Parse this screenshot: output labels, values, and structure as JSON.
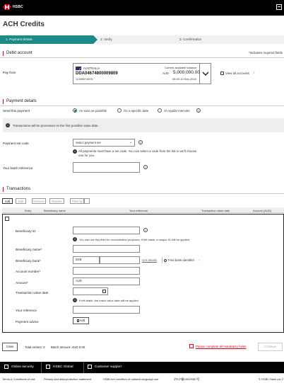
{
  "header": {
    "brand": "HSBC"
  },
  "page": {
    "title": "ACH Credits"
  },
  "steps": [
    "1. Payment details",
    "2. Verify",
    "3. Confirmation"
  ],
  "required_note": "*Indicates required fields",
  "debit": {
    "section": "Debit account",
    "pay_from_label": "Pay from",
    "country": "AUSTRALIA",
    "account": "DDA04674800009809",
    "account_sub": "12345576578",
    "balance_label": "Current available balance",
    "currency": "AUD",
    "balance": "5,000,000.00",
    "as_of": "08.00.10 Sep.2016",
    "view_all": "View all accounts"
  },
  "payment": {
    "section": "Payment details",
    "send_label": "Send this payment",
    "options": [
      "As soon as possible",
      "On a specific date",
      "At regular intervals"
    ],
    "banner": "Transactions will be processed on the first possible value date.",
    "setcode_label": "Payment set code",
    "setcode_placeholder": "Select payment set",
    "setcode_note": "All payments must have a set code. You can select a code from the list or we'll choose one for you.",
    "batchref_label": "Your batch reference"
  },
  "transactions": {
    "section": "Transactions",
    "toolbar": [
      "Add",
      "Edit",
      "Remove",
      "Restore",
      "Filter by"
    ],
    "columns": [
      "Entry",
      "Beneficiary name",
      "Your reference",
      "Transaction value date",
      "Amount (AUD)"
    ],
    "form": {
      "beneficiary_id": "Beneficiary ID",
      "beneficiary_id_note": "You can use this field for reconciliation purposes. If left blank, a unique ID will be applied.",
      "beneficiary_name": "Beneficiary name*",
      "beneficiary_bank": "Beneficiary bank*",
      "bsb": "BSB",
      "get_details": "Get details",
      "find_bank": "Find bank identifier",
      "account_number": "Account number*",
      "amount": "Amount*",
      "amount_ccy": "AUD",
      "value_date": "Transaction value date",
      "value_date_note": "If left blank, the batch value date will be applied",
      "your_reference": "Your reference",
      "payment_advice": "Payment advice",
      "add": "Add"
    }
  },
  "summary": {
    "close": "Close",
    "total_entries": "Total entries: 0",
    "batch_amount": "Batch amount: AUD 0.00",
    "complete_msg": "Please complete all mandatory fields",
    "continue": "Continue"
  },
  "footer": {
    "links": [
      "Online security",
      "HSBC Global",
      "Customer support"
    ],
    "bottom": [
      "Terms & Conditions of use",
      "Privacy and data protection statement",
      "HSBCnet condition of national language use",
      "沪ICP备15029387号",
      "© HSBC Bank plc 2"
    ]
  },
  "colors": {
    "accent": "#1c8a86",
    "red": "#db0011",
    "black": "#000000"
  }
}
